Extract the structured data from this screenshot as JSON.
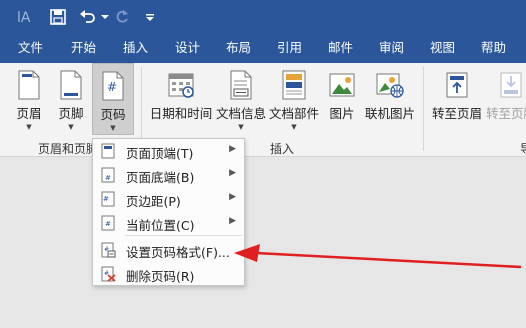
{
  "title_bar": {
    "quick_access": [
      "autosave-icon",
      "save-icon",
      "undo-icon",
      "redo-icon",
      "customize-icon"
    ]
  },
  "menu_tabs": [
    "文件",
    "开始",
    "插入",
    "设计",
    "布局",
    "引用",
    "邮件",
    "审阅",
    "视图",
    "帮助"
  ],
  "ribbon": {
    "buttons": {
      "header": "页眉",
      "footer": "页脚",
      "page_number": "页码",
      "date_time": "日期和时间",
      "doc_info": "文档信息",
      "doc_parts": "文档部件",
      "picture": "图片",
      "online_picture": "联机图片",
      "goto_header": "转至页眉",
      "goto_footer": "转至页脚"
    },
    "groups": {
      "header_footer": "页眉和页脚",
      "insert": "插入",
      "nav_partial": "导"
    }
  },
  "page_number_menu": {
    "items": [
      {
        "label": "页面顶端(T)",
        "submenu": true
      },
      {
        "label": "页面底端(B)",
        "submenu": true
      },
      {
        "label": "页边距(P)",
        "submenu": true
      },
      {
        "label": "当前位置(C)",
        "submenu": true
      },
      {
        "label": "设置页码格式(F)...",
        "submenu": false
      },
      {
        "label": "删除页码(R)",
        "submenu": false
      }
    ]
  },
  "colors": {
    "title_bar": "#2b579a",
    "ribbon_bg": "#f3f3f3",
    "annotation_arrow": "#e02020"
  }
}
